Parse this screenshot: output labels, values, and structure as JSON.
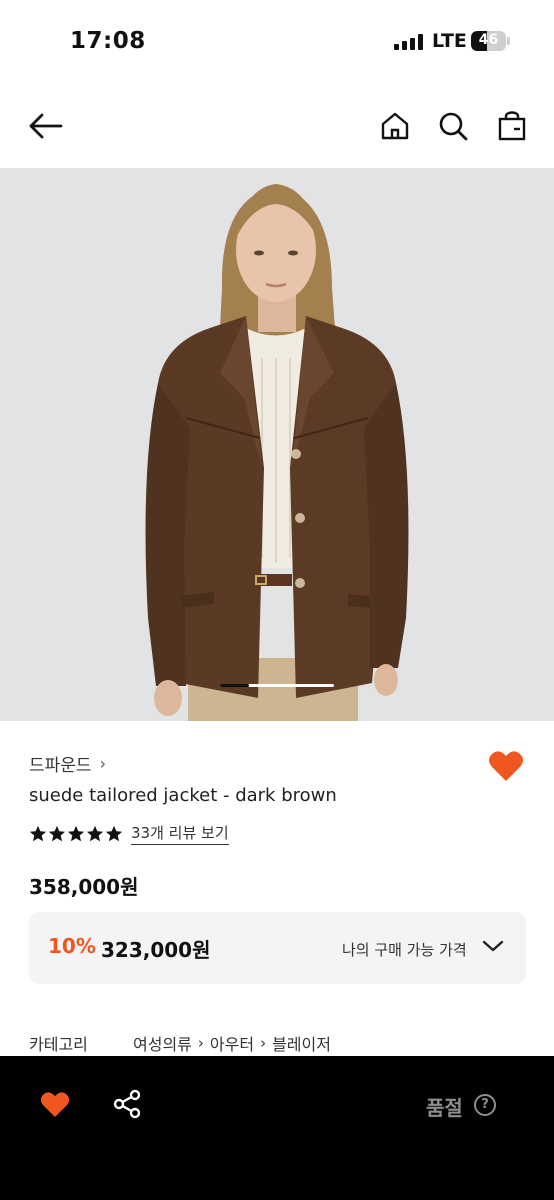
{
  "status_bar": {
    "time": "17:08",
    "network": "LTE",
    "battery": "46",
    "battery_level": 0.46
  },
  "nav": {
    "back_icon": "arrow-left-icon",
    "home_icon": "home-icon",
    "search_icon": "search-icon",
    "cart_icon": "shopping-bag-icon"
  },
  "gallery": {
    "current_index": 1,
    "indicator_progress": 0.25
  },
  "product": {
    "brand": "드파운드",
    "brand_chevron": "›",
    "name": "suede tailored jacket - dark brown",
    "rating_stars": 5,
    "reviews_link": "33개 리뷰 보기",
    "price": "358,000원",
    "discount_percent": "10%",
    "sale_price": "323,000원",
    "my_price_label": "나의 구매 가능 가격",
    "wishlisted": true
  },
  "category": {
    "label": "카테고리",
    "path": [
      "여성의류",
      "아우터",
      "블레이저"
    ],
    "separator": "›"
  },
  "bottom_bar": {
    "wish_icon": "heart-icon",
    "share_icon": "share-icon",
    "status": "품절",
    "help": "?"
  },
  "colors": {
    "accent": "#f0561f",
    "soldout_text": "#8e8e8e",
    "bottom_bg": "#000000",
    "pricebox_bg": "#f4f4f6"
  }
}
